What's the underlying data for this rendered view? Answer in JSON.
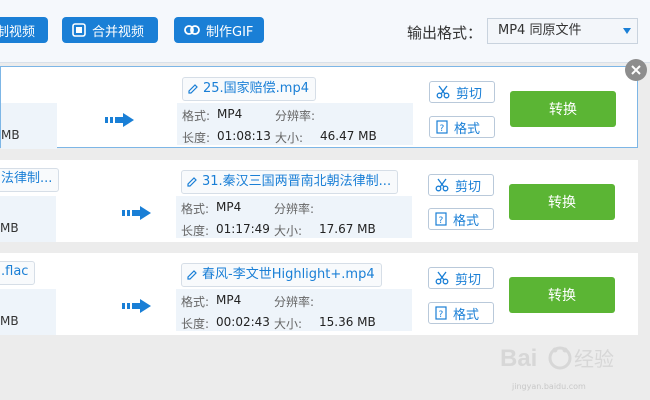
{
  "toolbar": {
    "btn1_label": "制视频",
    "btn2_label": "合并视频",
    "btn3_label": "制作GIF",
    "output_format_label": "输出格式：",
    "output_format_value": "MP4  同原文件"
  },
  "labels": {
    "format": "格式:",
    "resolution": "分辨率:",
    "duration": "长度:",
    "size": "大小:",
    "cut": "剪切",
    "format_btn": "格式",
    "convert": "转换"
  },
  "rows": [
    {
      "src_name": "",
      "src_size": "MB",
      "dst_name": "25.国家赔偿.mp4",
      "format": "MP4",
      "duration": "01:08:13",
      "size": "46.47 MB"
    },
    {
      "src_name": "法律制...",
      "src_size": "MB",
      "dst_name": "31.秦汉三国两晋南北朝法律制...",
      "format": "MP4",
      "duration": "01:17:49",
      "size": "17.67 MB"
    },
    {
      "src_name": ".flac",
      "src_size": "MB",
      "dst_name": "春风-李文世Highlight+.mp4",
      "format": "MP4",
      "duration": "00:02:43",
      "size": "15.36 MB"
    }
  ],
  "watermark": {
    "brand": "Bai",
    "brand2": "经验",
    "url": "jingyan.baidu.com"
  },
  "colors": {
    "accent": "#1a7fd6",
    "convert": "#5bb534"
  }
}
